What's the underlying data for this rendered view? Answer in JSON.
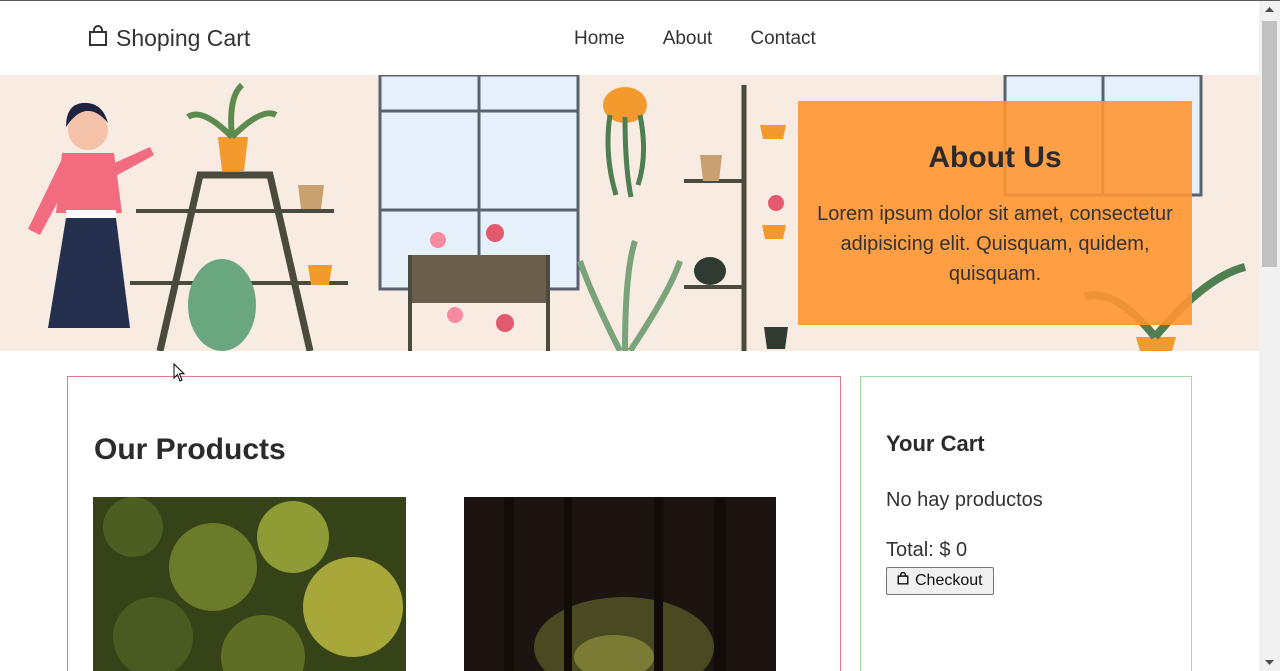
{
  "brand": {
    "label": "Shoping Cart",
    "icon": "shopping-bag-icon"
  },
  "nav": {
    "items": [
      "Home",
      "About",
      "Contact"
    ]
  },
  "hero": {
    "about_title": "About Us",
    "about_text": "Lorem ipsum dolor sit amet, consectetur adipisicing elit. Quisquam, quidem, quisquam.",
    "box_color": "#ff9a3c"
  },
  "products": {
    "title": "Our Products",
    "items": [
      {
        "image": "green-foliage-photo"
      },
      {
        "image": "dark-forest-photo"
      }
    ]
  },
  "cart": {
    "title": "Your Cart",
    "empty_text": "No hay productos",
    "total_text": "Total: $ 0",
    "checkout_label": "Checkout",
    "checkout_icon": "shopping-bag-icon"
  },
  "colors": {
    "products_border": "#e07a8a",
    "cart_border": "#9fdc9f",
    "hero_bg": "#f7ebe2"
  }
}
